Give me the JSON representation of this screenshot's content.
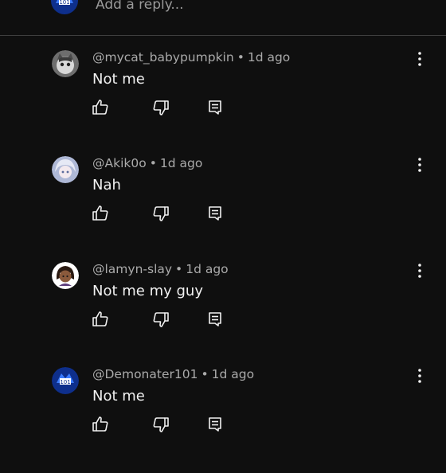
{
  "reply_box": {
    "placeholder": "Add a reply..."
  },
  "comments": [
    {
      "username": "@mycat_babypumpkin",
      "separator": "•",
      "time": "1d ago",
      "text": "Not me",
      "avatar_icon": "cat-avatar-icon"
    },
    {
      "username": "@Akik0o",
      "separator": "•",
      "time": "1d ago",
      "text": "Nah",
      "avatar_icon": "anime-avatar-icon"
    },
    {
      "username": "@lamyn-slay",
      "separator": "•",
      "time": "1d ago",
      "text": "Not me my guy",
      "avatar_icon": "girl-avatar-icon"
    },
    {
      "username": "@Demonater101",
      "separator": "•",
      "time": "1d ago",
      "text": "Not me",
      "avatar_icon": "gamer-avatar-icon"
    }
  ],
  "colors": {
    "background": "#0f0f0f",
    "primary_text": "#f1f1f1",
    "secondary_text": "#aaaaaa"
  }
}
